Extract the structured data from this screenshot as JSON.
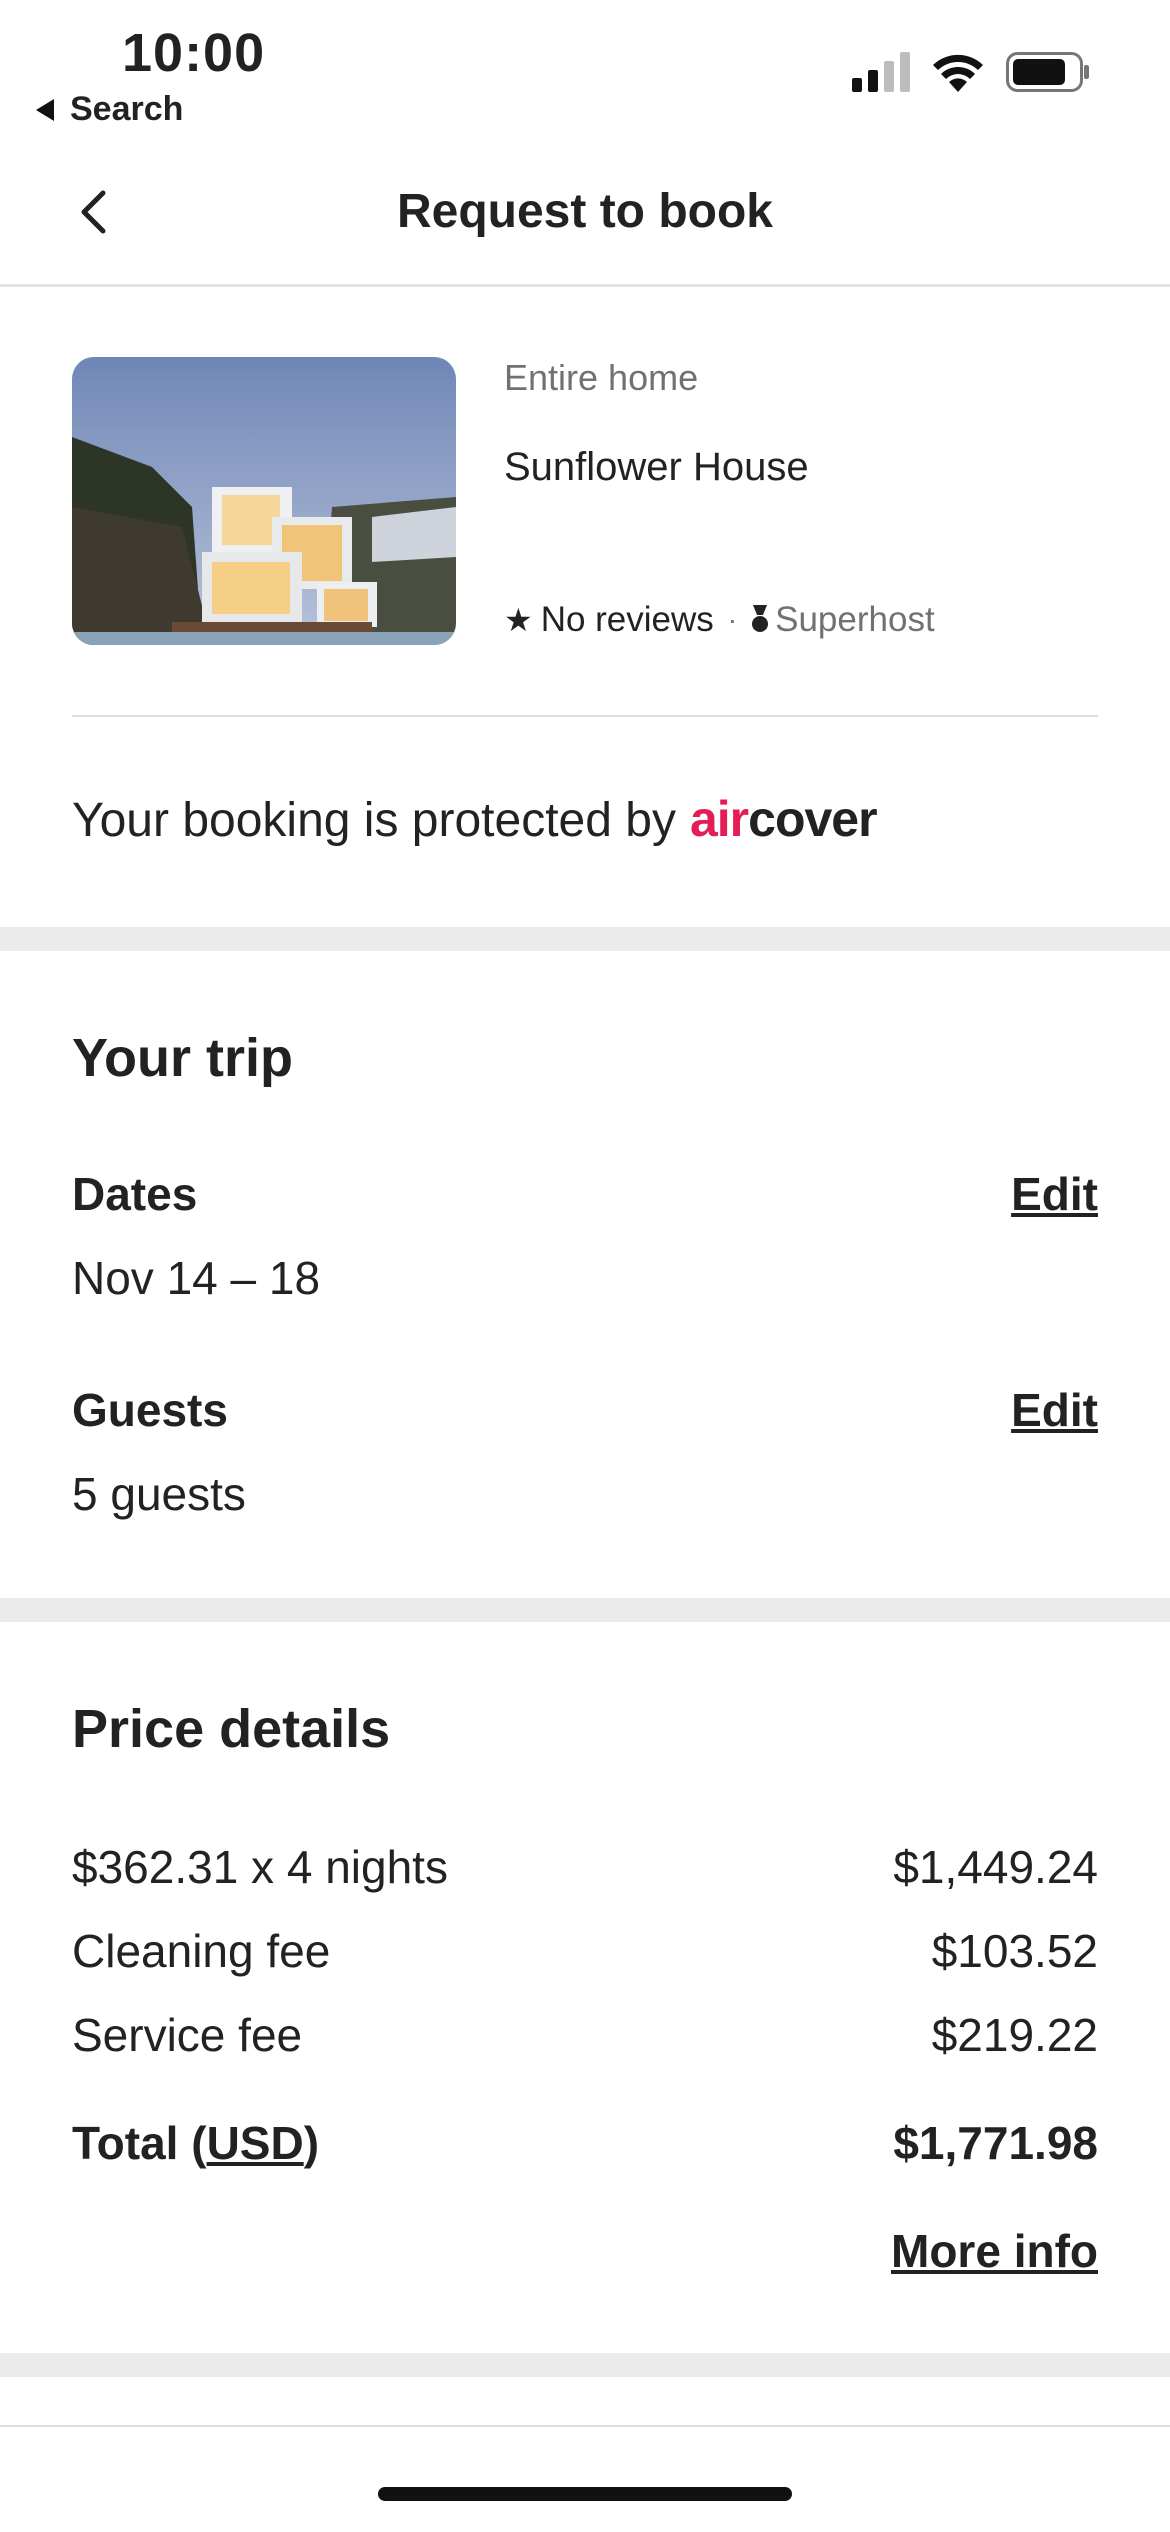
{
  "status_bar": {
    "time": "10:00",
    "back_app_label": "Search",
    "icons": [
      "cellular-signal-icon",
      "wifi-icon",
      "battery-icon"
    ]
  },
  "header": {
    "title": "Request to book",
    "back_icon": "chevron-left-icon"
  },
  "listing": {
    "type": "Entire home",
    "name": "Sunflower House",
    "reviews": "No reviews",
    "separator": "·",
    "badge": "Superhost"
  },
  "aircover": {
    "text": "Your booking is protected by",
    "logo_air": "air",
    "logo_cover": "cover",
    "brand_color": "#e41d57"
  },
  "trip": {
    "title": "Your trip",
    "dates_label": "Dates",
    "dates_value": "Nov 14 – 18",
    "guests_label": "Guests",
    "guests_value": "5 guests",
    "edit_label": "Edit"
  },
  "price": {
    "title": "Price details",
    "rows": [
      {
        "label": "$362.31 x 4 nights",
        "value": "$1,449.24"
      },
      {
        "label": "Cleaning fee",
        "value": "$103.52"
      },
      {
        "label": "Service fee",
        "value": "$219.22"
      }
    ],
    "total_label": "Total (",
    "total_currency": "USD",
    "total_close": ")",
    "total_value": "$1,771.98",
    "more_info": "More info"
  }
}
